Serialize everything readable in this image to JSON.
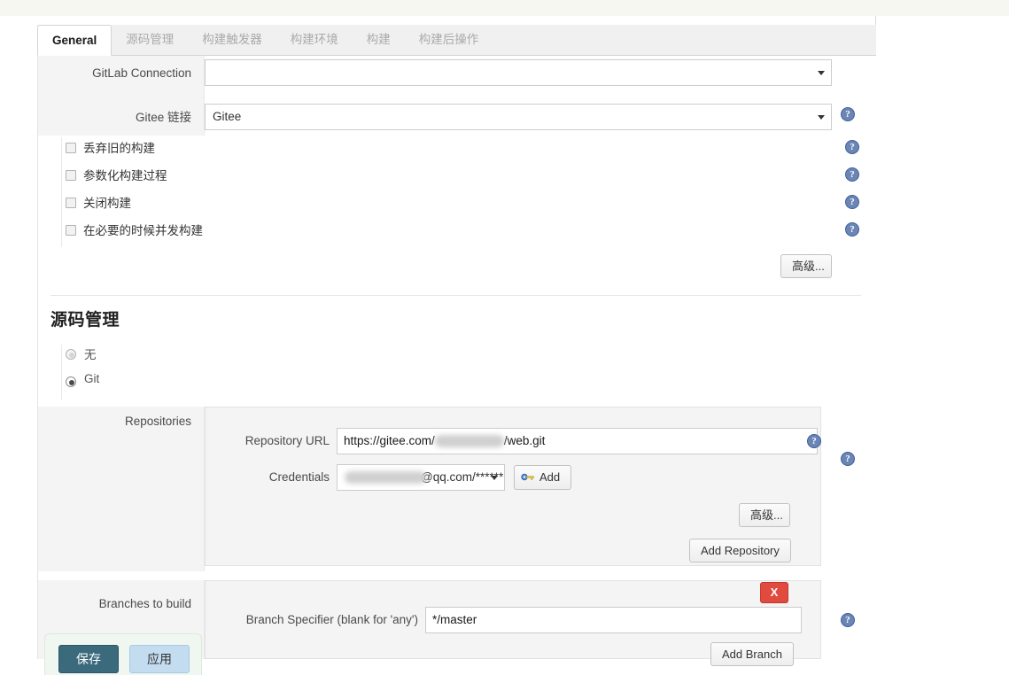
{
  "tabs": [
    {
      "label": "General",
      "active": true
    },
    {
      "label": "源码管理",
      "active": false
    },
    {
      "label": "构建触发器",
      "active": false
    },
    {
      "label": "构建环境",
      "active": false
    },
    {
      "label": "构建",
      "active": false
    },
    {
      "label": "构建后操作",
      "active": false
    }
  ],
  "general": {
    "gitlab_connection": {
      "label": "GitLab Connection",
      "value": ""
    },
    "gitee_link": {
      "label": "Gitee 链接",
      "value": "Gitee"
    },
    "checkboxes": [
      {
        "label": "丢弃旧的构建",
        "checked": false
      },
      {
        "label": "参数化构建过程",
        "checked": false
      },
      {
        "label": "关闭构建",
        "checked": false
      },
      {
        "label": "在必要的时候并发构建",
        "checked": false
      }
    ],
    "advanced_button": "高级..."
  },
  "scm": {
    "heading": "源码管理",
    "options": [
      {
        "label": "无",
        "selected": false
      },
      {
        "label": "Git",
        "selected": true
      }
    ],
    "repositories": {
      "label": "Repositories",
      "repository_url": {
        "label": "Repository URL",
        "prefix": "https://gitee.com/",
        "suffix": "/web.git",
        "redacted": true
      },
      "credentials": {
        "label": "Credentials",
        "prefix": "",
        "suffix": "@qq.com/******",
        "redacted": true
      },
      "add_credentials_button": "Add",
      "advanced_button": "高级...",
      "add_repository_button": "Add Repository"
    },
    "branches": {
      "label": "Branches to build",
      "branch_specifier": {
        "label": "Branch Specifier (blank for 'any')",
        "value": "*/master"
      },
      "delete_button": "X",
      "add_branch_button": "Add Branch"
    }
  },
  "footer": {
    "save_button": "保存",
    "apply_button": "应用"
  },
  "icons": {
    "help": "?",
    "key": "key-icon"
  },
  "colors": {
    "accent_save": "#3b6a7d",
    "accent_apply": "#c3dcf0",
    "help_blue": "#6b86b5",
    "delete_red": "#e04a3f"
  }
}
